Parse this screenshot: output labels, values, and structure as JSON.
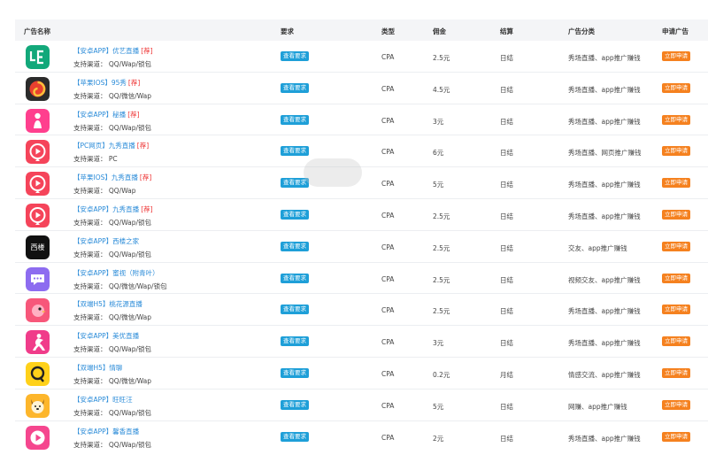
{
  "header": {
    "name": "广告名称",
    "requirement": "要求",
    "type": "类型",
    "commission": "佣金",
    "settlement": "结算",
    "category": "广告分类",
    "apply": "申请广告"
  },
  "rows": [
    {
      "logo": "ue-logo-icon",
      "title": "【安卓APP】优艺直播",
      "flag": "[荐]",
      "channels": "支持渠道：  QQ/Wap/锁包",
      "req": "查看要求",
      "type": "CPA",
      "commission": "2.5元",
      "settlement": "日结",
      "category": "秀场直播、app推广赚钱",
      "apply": "立即申请"
    },
    {
      "logo": "swirl-logo-icon",
      "title": "【苹果IOS】95秀",
      "flag": "[荐]",
      "channels": "支持渠道：  QQ/微信/Wap",
      "req": "查看要求",
      "type": "CPA",
      "commission": "4.5元",
      "settlement": "日结",
      "category": "秀场直播、app推广赚钱",
      "apply": "立即申请"
    },
    {
      "logo": "pink-figure-logo-icon",
      "title": "【安卓APP】秘播",
      "flag": "[荐]",
      "channels": "支持渠道：  QQ/Wap/锁包",
      "req": "查看要求",
      "type": "CPA",
      "commission": "3元",
      "settlement": "日结",
      "category": "秀场直播、app推广赚钱",
      "apply": "立即申请"
    },
    {
      "logo": "play-logo-icon",
      "title": "【PC网页】九秀直播",
      "flag": "[荐]",
      "channels": "支持渠道：  PC",
      "req": "查看要求",
      "type": "CPA",
      "commission": "6元",
      "settlement": "日结",
      "category": "秀场直播、网页推广赚钱",
      "apply": "立即申请"
    },
    {
      "logo": "play-logo-icon",
      "title": "【苹果IOS】九秀直播",
      "flag": "[荐]",
      "channels": "支持渠道：  QQ/Wap",
      "req": "查看要求",
      "type": "CPA",
      "commission": "5元",
      "settlement": "日结",
      "category": "秀场直播、app推广赚钱",
      "apply": "立即申请"
    },
    {
      "logo": "play-logo-icon",
      "title": "【安卓APP】九秀直播",
      "flag": "[荐]",
      "channels": "支持渠道：  QQ/Wap/锁包",
      "req": "查看要求",
      "type": "CPA",
      "commission": "2.5元",
      "settlement": "日结",
      "category": "秀场直播、app推广赚钱",
      "apply": "立即申请"
    },
    {
      "logo": "xilou-logo-icon",
      "logo_text": "西楼",
      "title": "【安卓APP】西楼之家",
      "flag": "",
      "channels": "支持渠道：  QQ/Wap/锁包",
      "req": "查看要求",
      "type": "CPA",
      "commission": "2.5元",
      "settlement": "日结",
      "category": "交友、app推广赚钱",
      "apply": "立即申请"
    },
    {
      "logo": "chat-bubble-logo-icon",
      "title": "【安卓APP】蜜视（附青叶）",
      "flag": "",
      "channels": "支持渠道：  QQ/微信/Wap/锁包",
      "req": "查看要求",
      "type": "CPA",
      "commission": "2.5元",
      "settlement": "日结",
      "category": "视频交友、app推广赚钱",
      "apply": "立即申请"
    },
    {
      "logo": "bird-logo-icon",
      "title": "【双端H5】桃花源直播",
      "flag": "",
      "channels": "支持渠道：  QQ/微信/Wap",
      "req": "查看要求",
      "type": "CPA",
      "commission": "2.5元",
      "settlement": "日结",
      "category": "秀场直播、app推广赚钱",
      "apply": "立即申请"
    },
    {
      "logo": "dancer-logo-icon",
      "title": "【安卓APP】美优直播",
      "flag": "",
      "channels": "支持渠道：  QQ/Wap/锁包",
      "req": "查看要求",
      "type": "CPA",
      "commission": "3元",
      "settlement": "日结",
      "category": "秀场直播、app推广赚钱",
      "apply": "立即申请"
    },
    {
      "logo": "q-logo-icon",
      "title": "【双端H5】情聊",
      "flag": "",
      "channels": "支持渠道：  QQ/微信/Wap",
      "req": "查看要求",
      "type": "CPA",
      "commission": "0.2元",
      "settlement": "月结",
      "category": "情感交流、app推广赚钱",
      "apply": "立即申请"
    },
    {
      "logo": "dog-logo-icon",
      "title": "【安卓APP】旺旺汪",
      "flag": "",
      "channels": "支持渠道：  QQ/Wap/锁包",
      "req": "查看要求",
      "type": "CPA",
      "commission": "5元",
      "settlement": "日结",
      "category": "网赚、app推广赚钱",
      "apply": "立即申请"
    },
    {
      "logo": "pink-play-logo-icon",
      "title": "【安卓APP】馨香直播",
      "flag": "",
      "channels": "支持渠道：  QQ/Wap/锁包",
      "req": "查看要求",
      "type": "CPA",
      "commission": "2元",
      "settlement": "日结",
      "category": "秀场直播、app推广赚钱",
      "apply": "立即申请"
    }
  ]
}
